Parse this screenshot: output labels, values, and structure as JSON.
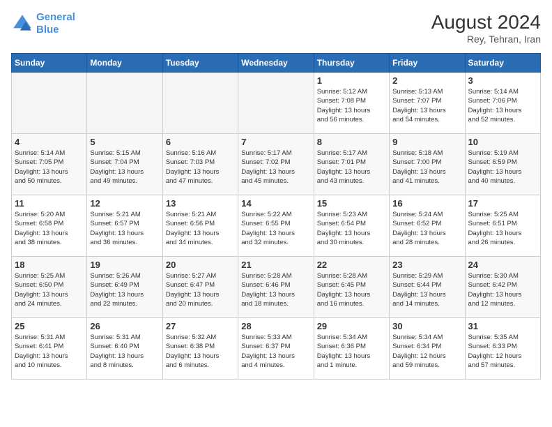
{
  "header": {
    "logo_line1": "General",
    "logo_line2": "Blue",
    "month_year": "August 2024",
    "location": "Rey, Tehran, Iran"
  },
  "weekdays": [
    "Sunday",
    "Monday",
    "Tuesday",
    "Wednesday",
    "Thursday",
    "Friday",
    "Saturday"
  ],
  "weeks": [
    [
      {
        "day": "",
        "info": "",
        "empty": true
      },
      {
        "day": "",
        "info": "",
        "empty": true
      },
      {
        "day": "",
        "info": "",
        "empty": true
      },
      {
        "day": "",
        "info": "",
        "empty": true
      },
      {
        "day": "1",
        "info": "Sunrise: 5:12 AM\nSunset: 7:08 PM\nDaylight: 13 hours\nand 56 minutes."
      },
      {
        "day": "2",
        "info": "Sunrise: 5:13 AM\nSunset: 7:07 PM\nDaylight: 13 hours\nand 54 minutes."
      },
      {
        "day": "3",
        "info": "Sunrise: 5:14 AM\nSunset: 7:06 PM\nDaylight: 13 hours\nand 52 minutes."
      }
    ],
    [
      {
        "day": "4",
        "info": "Sunrise: 5:14 AM\nSunset: 7:05 PM\nDaylight: 13 hours\nand 50 minutes."
      },
      {
        "day": "5",
        "info": "Sunrise: 5:15 AM\nSunset: 7:04 PM\nDaylight: 13 hours\nand 49 minutes."
      },
      {
        "day": "6",
        "info": "Sunrise: 5:16 AM\nSunset: 7:03 PM\nDaylight: 13 hours\nand 47 minutes."
      },
      {
        "day": "7",
        "info": "Sunrise: 5:17 AM\nSunset: 7:02 PM\nDaylight: 13 hours\nand 45 minutes."
      },
      {
        "day": "8",
        "info": "Sunrise: 5:17 AM\nSunset: 7:01 PM\nDaylight: 13 hours\nand 43 minutes."
      },
      {
        "day": "9",
        "info": "Sunrise: 5:18 AM\nSunset: 7:00 PM\nDaylight: 13 hours\nand 41 minutes."
      },
      {
        "day": "10",
        "info": "Sunrise: 5:19 AM\nSunset: 6:59 PM\nDaylight: 13 hours\nand 40 minutes."
      }
    ],
    [
      {
        "day": "11",
        "info": "Sunrise: 5:20 AM\nSunset: 6:58 PM\nDaylight: 13 hours\nand 38 minutes."
      },
      {
        "day": "12",
        "info": "Sunrise: 5:21 AM\nSunset: 6:57 PM\nDaylight: 13 hours\nand 36 minutes."
      },
      {
        "day": "13",
        "info": "Sunrise: 5:21 AM\nSunset: 6:56 PM\nDaylight: 13 hours\nand 34 minutes."
      },
      {
        "day": "14",
        "info": "Sunrise: 5:22 AM\nSunset: 6:55 PM\nDaylight: 13 hours\nand 32 minutes."
      },
      {
        "day": "15",
        "info": "Sunrise: 5:23 AM\nSunset: 6:54 PM\nDaylight: 13 hours\nand 30 minutes."
      },
      {
        "day": "16",
        "info": "Sunrise: 5:24 AM\nSunset: 6:52 PM\nDaylight: 13 hours\nand 28 minutes."
      },
      {
        "day": "17",
        "info": "Sunrise: 5:25 AM\nSunset: 6:51 PM\nDaylight: 13 hours\nand 26 minutes."
      }
    ],
    [
      {
        "day": "18",
        "info": "Sunrise: 5:25 AM\nSunset: 6:50 PM\nDaylight: 13 hours\nand 24 minutes."
      },
      {
        "day": "19",
        "info": "Sunrise: 5:26 AM\nSunset: 6:49 PM\nDaylight: 13 hours\nand 22 minutes."
      },
      {
        "day": "20",
        "info": "Sunrise: 5:27 AM\nSunset: 6:47 PM\nDaylight: 13 hours\nand 20 minutes."
      },
      {
        "day": "21",
        "info": "Sunrise: 5:28 AM\nSunset: 6:46 PM\nDaylight: 13 hours\nand 18 minutes."
      },
      {
        "day": "22",
        "info": "Sunrise: 5:28 AM\nSunset: 6:45 PM\nDaylight: 13 hours\nand 16 minutes."
      },
      {
        "day": "23",
        "info": "Sunrise: 5:29 AM\nSunset: 6:44 PM\nDaylight: 13 hours\nand 14 minutes."
      },
      {
        "day": "24",
        "info": "Sunrise: 5:30 AM\nSunset: 6:42 PM\nDaylight: 13 hours\nand 12 minutes."
      }
    ],
    [
      {
        "day": "25",
        "info": "Sunrise: 5:31 AM\nSunset: 6:41 PM\nDaylight: 13 hours\nand 10 minutes."
      },
      {
        "day": "26",
        "info": "Sunrise: 5:31 AM\nSunset: 6:40 PM\nDaylight: 13 hours\nand 8 minutes."
      },
      {
        "day": "27",
        "info": "Sunrise: 5:32 AM\nSunset: 6:38 PM\nDaylight: 13 hours\nand 6 minutes."
      },
      {
        "day": "28",
        "info": "Sunrise: 5:33 AM\nSunset: 6:37 PM\nDaylight: 13 hours\nand 4 minutes."
      },
      {
        "day": "29",
        "info": "Sunrise: 5:34 AM\nSunset: 6:36 PM\nDaylight: 13 hours\nand 1 minute."
      },
      {
        "day": "30",
        "info": "Sunrise: 5:34 AM\nSunset: 6:34 PM\nDaylight: 12 hours\nand 59 minutes."
      },
      {
        "day": "31",
        "info": "Sunrise: 5:35 AM\nSunset: 6:33 PM\nDaylight: 12 hours\nand 57 minutes."
      }
    ]
  ]
}
